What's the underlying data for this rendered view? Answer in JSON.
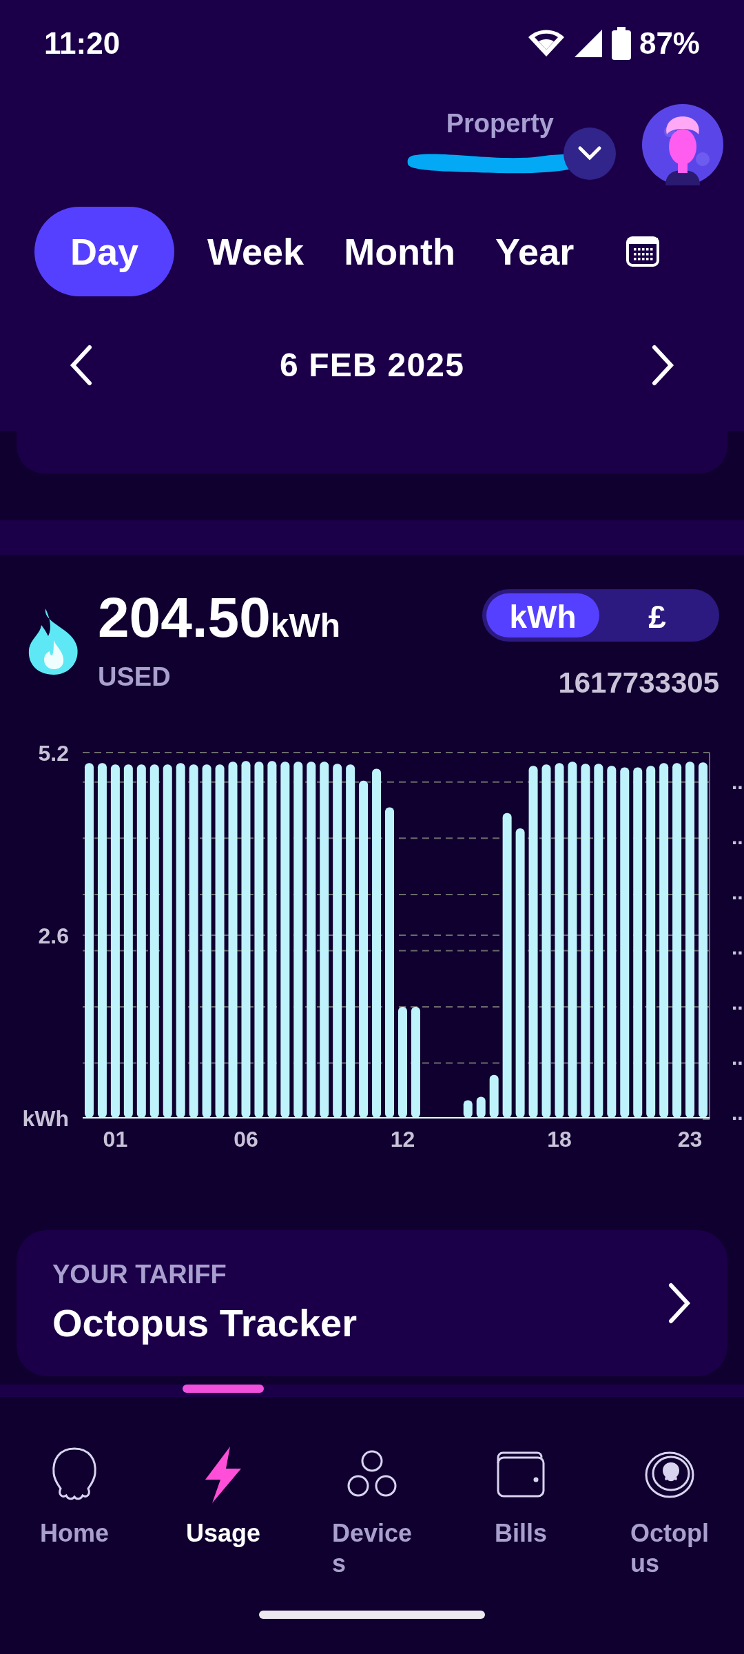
{
  "status_bar": {
    "time": "11:20",
    "battery": "87%"
  },
  "header": {
    "property_label": "Property"
  },
  "tabs": [
    {
      "label": "Day",
      "selected": true
    },
    {
      "label": "Week",
      "selected": false
    },
    {
      "label": "Month",
      "selected": false
    },
    {
      "label": "Year",
      "selected": false
    }
  ],
  "date_nav": {
    "date": "6 FEB 2025"
  },
  "usage": {
    "value": "204.50",
    "unit": "kWh",
    "caption": "USED",
    "meter": "1617733305"
  },
  "unit_toggle": [
    {
      "label": "kWh",
      "selected": true
    },
    {
      "label": "£",
      "selected": false
    }
  ],
  "chart": {
    "chart_data": {
      "type": "bar",
      "ylabel": "kWh",
      "categories": [
        null,
        null,
        "01",
        null,
        null,
        null,
        null,
        null,
        null,
        null,
        null,
        null,
        "06",
        null,
        null,
        null,
        null,
        null,
        null,
        null,
        null,
        null,
        null,
        null,
        "12",
        null,
        null,
        null,
        null,
        null,
        null,
        null,
        null,
        null,
        null,
        null,
        "18",
        null,
        null,
        null,
        null,
        null,
        null,
        null,
        null,
        null,
        "23",
        null
      ],
      "values": [
        5.05,
        5.05,
        5.03,
        5.03,
        5.03,
        5.03,
        5.03,
        5.05,
        5.03,
        5.03,
        5.03,
        5.07,
        5.08,
        5.07,
        5.08,
        5.07,
        5.07,
        5.07,
        5.07,
        5.04,
        5.03,
        4.8,
        4.97,
        4.42,
        1.58,
        1.58,
        0,
        0,
        0,
        0.25,
        0.3,
        0.61,
        4.34,
        4.12,
        5.01,
        5.03,
        5.05,
        5.07,
        5.04,
        5.04,
        5.01,
        4.99,
        4.99,
        5.01,
        5.05,
        5.05,
        5.07,
        5.06
      ],
      "ylim": [
        0,
        5.2
      ],
      "yticks": [
        2.6,
        5.2
      ]
    },
    "right_ticks": [
      "..",
      "..",
      "..",
      "..",
      "..",
      "..",
      ".."
    ]
  },
  "tariff": {
    "label": "YOUR TARIFF",
    "name": "Octopus Tracker"
  },
  "nav": [
    {
      "label": "Home",
      "selected": false
    },
    {
      "label": "Usage",
      "selected": true
    },
    {
      "label": "Device\ns",
      "selected": false
    },
    {
      "label": "Bills",
      "selected": false
    },
    {
      "label": "Octopl\nus",
      "selected": false
    }
  ]
}
